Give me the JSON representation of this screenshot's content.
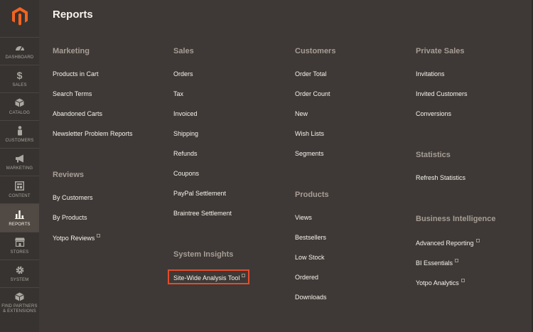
{
  "sidebar": {
    "items": [
      {
        "label": "DASHBOARD",
        "icon": "dashboard-icon"
      },
      {
        "label": "SALES",
        "icon": "dollar-icon"
      },
      {
        "label": "CATALOG",
        "icon": "box-icon"
      },
      {
        "label": "CUSTOMERS",
        "icon": "person-icon"
      },
      {
        "label": "MARKETING",
        "icon": "megaphone-icon"
      },
      {
        "label": "CONTENT",
        "icon": "layout-icon"
      },
      {
        "label": "REPORTS",
        "icon": "bar-chart-icon"
      },
      {
        "label": "STORES",
        "icon": "storefront-icon"
      },
      {
        "label": "SYSTEM",
        "icon": "gear-icon"
      },
      {
        "label": "FIND PARTNERS\n& EXTENSIONS",
        "icon": "cube-icon"
      }
    ]
  },
  "page": {
    "title": "Reports"
  },
  "columns": {
    "marketing": {
      "title": "Marketing",
      "links": [
        "Products in Cart",
        "Search Terms",
        "Abandoned Carts",
        "Newsletter Problem Reports"
      ]
    },
    "reviews": {
      "title": "Reviews",
      "links": [
        "By Customers",
        "By Products",
        "Yotpo Reviews"
      ]
    },
    "sales": {
      "title": "Sales",
      "links": [
        "Orders",
        "Tax",
        "Invoiced",
        "Shipping",
        "Refunds",
        "Coupons",
        "PayPal Settlement",
        "Braintree Settlement"
      ]
    },
    "system_insights": {
      "title": "System Insights",
      "links": [
        "Site-Wide Analysis Tool"
      ]
    },
    "customers": {
      "title": "Customers",
      "links": [
        "Order Total",
        "Order Count",
        "New",
        "Wish Lists",
        "Segments"
      ]
    },
    "products": {
      "title": "Products",
      "links": [
        "Views",
        "Bestsellers",
        "Low Stock",
        "Ordered",
        "Downloads"
      ]
    },
    "private_sales": {
      "title": "Private Sales",
      "links": [
        "Invitations",
        "Invited Customers",
        "Conversions"
      ]
    },
    "statistics": {
      "title": "Statistics",
      "links": [
        "Refresh Statistics"
      ]
    },
    "business_intelligence": {
      "title": "Business Intelligence",
      "links": [
        "Advanced Reporting",
        "BI Essentials",
        "Yotpo Analytics"
      ]
    }
  },
  "colors": {
    "accent": "#e54b2c",
    "sidebar_bg": "#373330",
    "main_bg": "#3e3936"
  }
}
